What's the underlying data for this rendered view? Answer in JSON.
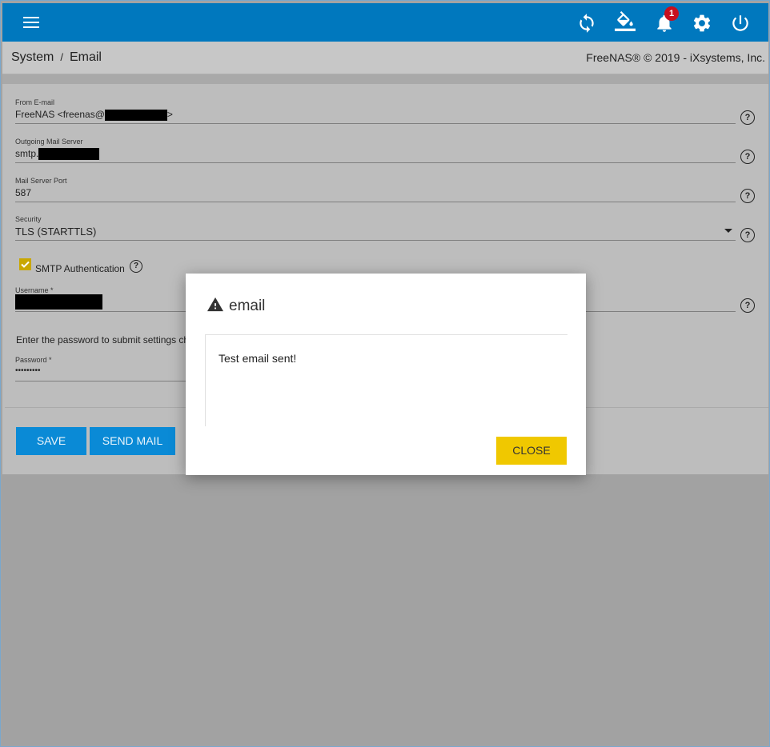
{
  "topbar": {
    "icons": [
      "refresh-icon",
      "paint-bucket-icon",
      "bell-icon",
      "gear-icon",
      "power-icon"
    ],
    "notification_count": "1",
    "accent": "#0078be"
  },
  "breadcrumb": {
    "section": "System",
    "separator": "/",
    "page": "Email"
  },
  "copyright": "FreeNAS® © 2019 - iXsystems, Inc.",
  "form": {
    "from_email": {
      "label": "From E-mail",
      "value_prefix": "FreeNAS <freenas@",
      "value_suffix": ">"
    },
    "mail_server": {
      "label": "Outgoing Mail Server",
      "value_prefix": "smtp."
    },
    "port": {
      "label": "Mail Server Port",
      "value": "587"
    },
    "security": {
      "label": "Security",
      "value": "TLS (STARTTLS)"
    },
    "smtp_auth": {
      "label": "SMTP Authentication",
      "checked": true
    },
    "username": {
      "label": "Username *"
    },
    "password_note": "Enter the password to submit settings ch",
    "password": {
      "label": "Password *",
      "value": "•••••••••"
    },
    "help_glyph": "?"
  },
  "buttons": {
    "save": "SAVE",
    "send_mail": "SEND MAIL"
  },
  "dialog": {
    "title": "email",
    "icon": "warning-icon",
    "message": "Test email sent!",
    "close": "CLOSE",
    "close_color": "#f0c800"
  }
}
